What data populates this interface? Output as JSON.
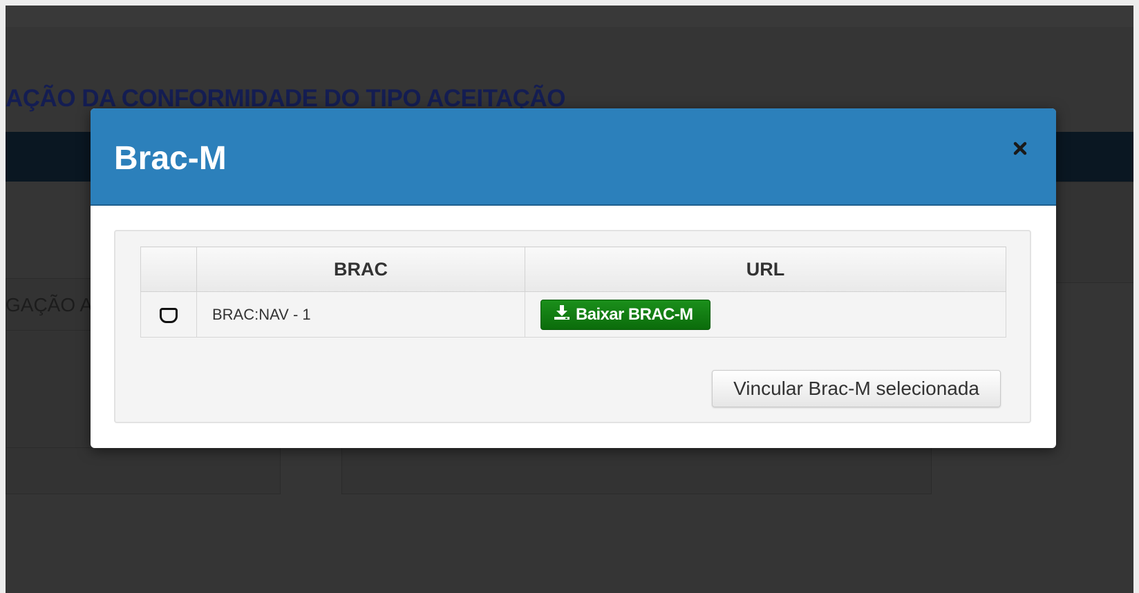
{
  "background": {
    "page_title": "AÇÃO DA CONFORMIDADE DO TIPO ACEITAÇÃO",
    "partial_label": "GAÇÃO A"
  },
  "modal": {
    "title": "Brac-M",
    "close_icon": "close-icon",
    "header_color": "#2c80bb",
    "table": {
      "columns": [
        "",
        "BRAC",
        "URL"
      ],
      "rows": [
        {
          "selected": false,
          "brac": "BRAC:NAV - 1",
          "download_label": "Baixar BRAC-M",
          "download_icon": "download-icon"
        }
      ]
    },
    "link_button_label": "Vincular Brac-M selecionada",
    "download_button_color": "#0e7a0e"
  }
}
